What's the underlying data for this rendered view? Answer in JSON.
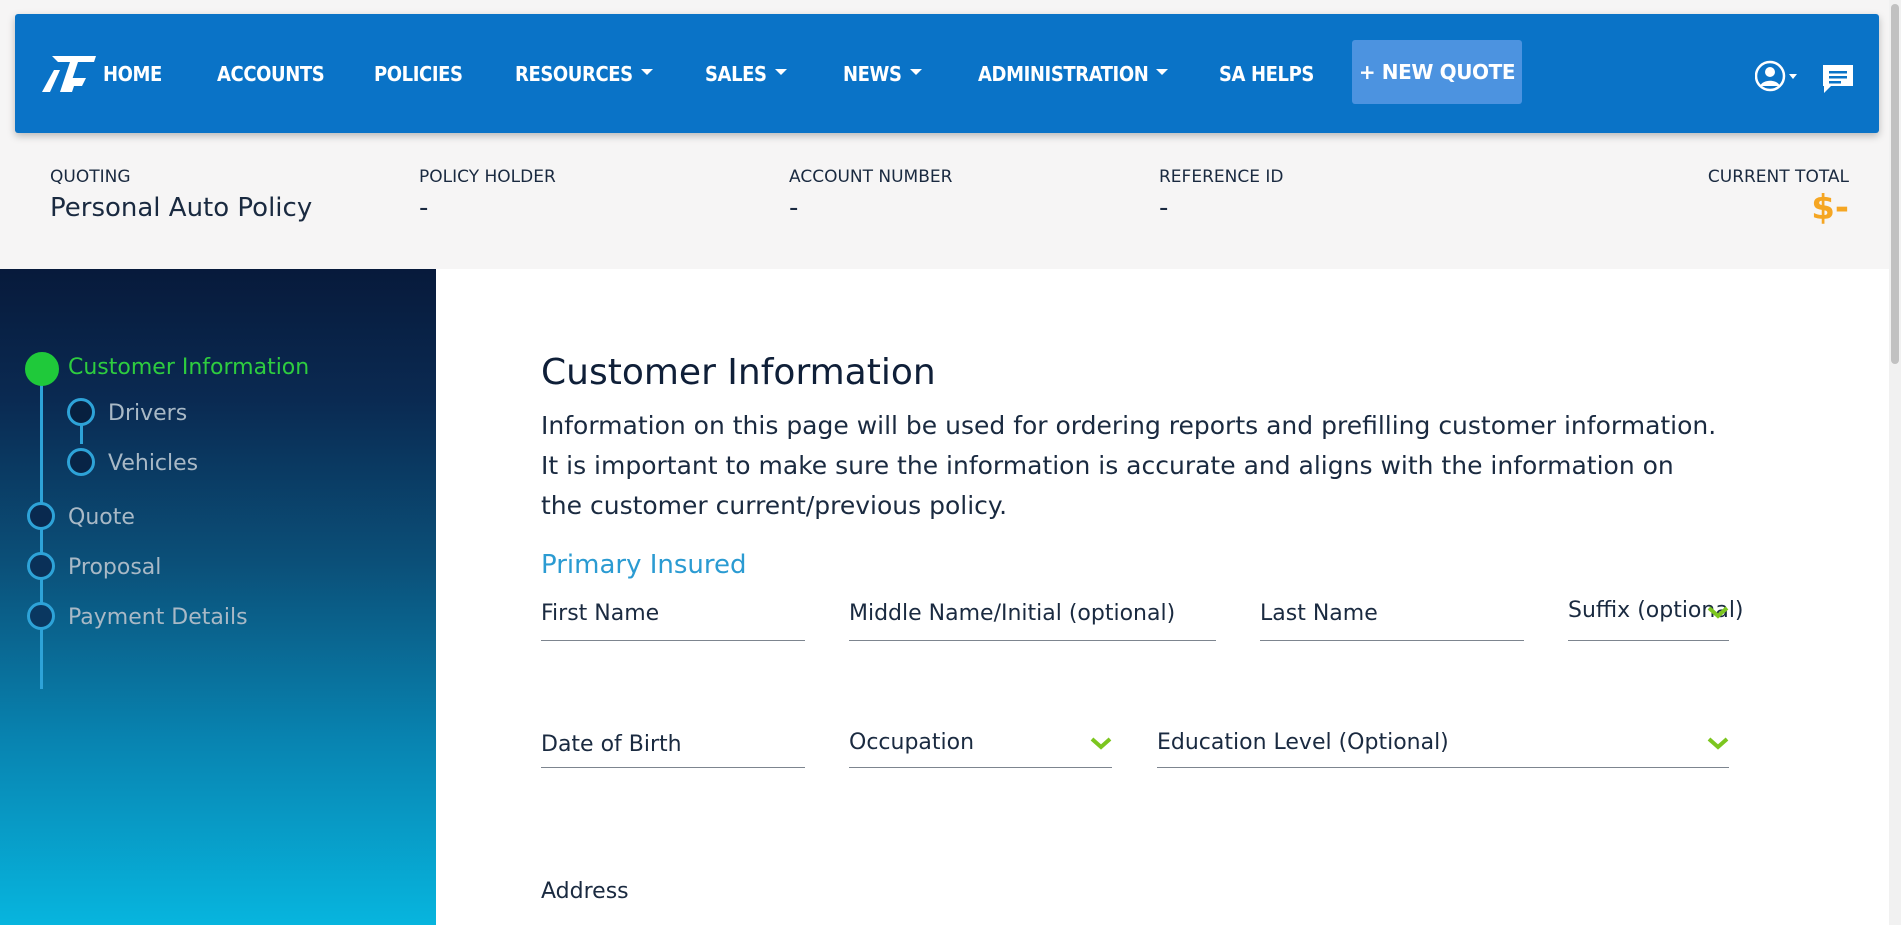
{
  "nav": {
    "items": [
      {
        "label": "HOME"
      },
      {
        "label": "ACCOUNTS"
      },
      {
        "label": "POLICIES"
      },
      {
        "label": "RESOURCES"
      },
      {
        "label": "SALES"
      },
      {
        "label": "NEWS"
      },
      {
        "label": "ADMINISTRATION"
      },
      {
        "label": "SA HELPS"
      }
    ],
    "new_quote_label": "+ NEW QUOTE",
    "icons": [
      "logo",
      "user-icon",
      "chat-icon"
    ]
  },
  "summary": {
    "quoting_label": "QUOTING",
    "quoting_value": "Personal Auto Policy",
    "policy_holder_label": "POLICY HOLDER",
    "policy_holder_value": "-",
    "account_number_label": "ACCOUNT NUMBER",
    "account_number_value": "-",
    "reference_id_label": "REFERENCE ID",
    "reference_id_value": "-",
    "current_total_label": "CURRENT TOTAL",
    "current_total_value": "$-"
  },
  "steps": [
    {
      "label": "Customer Information",
      "active": true
    },
    {
      "label": "Drivers"
    },
    {
      "label": "Vehicles"
    },
    {
      "label": "Quote"
    },
    {
      "label": "Proposal"
    },
    {
      "label": "Payment Details"
    }
  ],
  "main": {
    "title": "Customer Information",
    "description": "Information on this page will be used for ordering reports and prefilling customer information. It is important to make sure the information is accurate and aligns with the information on the customer current/previous policy.",
    "section_title": "Primary Insured",
    "fields": {
      "first_name": "First Name",
      "middle_name": "Middle Name/Initial (optional)",
      "last_name": "Last Name",
      "suffix": "Suffix (optional)",
      "date_of_birth": "Date of Birth",
      "occupation": "Occupation",
      "education_level": "Education Level (Optional)",
      "address": "Address"
    }
  },
  "colors": {
    "nav_bg": "#0a73c7",
    "new_quote_bg": "#4c93e0",
    "active_step": "#1fc93a",
    "section_title": "#2b9bd2",
    "total_value": "#f5a623",
    "dropdown_arrow": "#7cc61f"
  }
}
